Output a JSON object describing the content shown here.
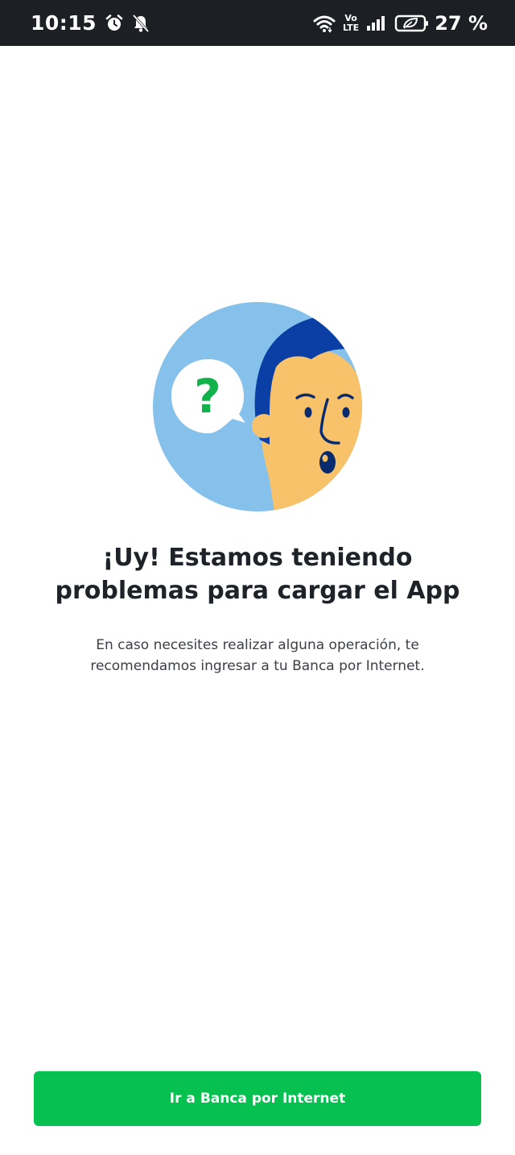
{
  "status_bar": {
    "time": "10:15",
    "network_top": "Vo",
    "network_bottom": "LTE",
    "battery_percent": "27 %",
    "icons": [
      "alarm-icon",
      "notifications-off-icon",
      "wifi-icon",
      "volte-icon",
      "signal-icon",
      "battery-saver-icon"
    ]
  },
  "illustration": {
    "bubble_text": "?",
    "colors": {
      "background_circle": "#85c1ea",
      "hair": "#0b3fa5",
      "skin": "#f8c26b",
      "bubble": "#ffffff",
      "question_mark": "#11b24c",
      "features": "#0a2a6e"
    }
  },
  "message": {
    "title": "¡Uy! Estamos teniendo problemas para cargar el App",
    "body": "En caso necesites realizar alguna operación, te recomendamos ingresar a tu Banca por Internet."
  },
  "actions": {
    "primary_label": "Ir a Banca por Internet",
    "primary_color": "#06c150"
  }
}
